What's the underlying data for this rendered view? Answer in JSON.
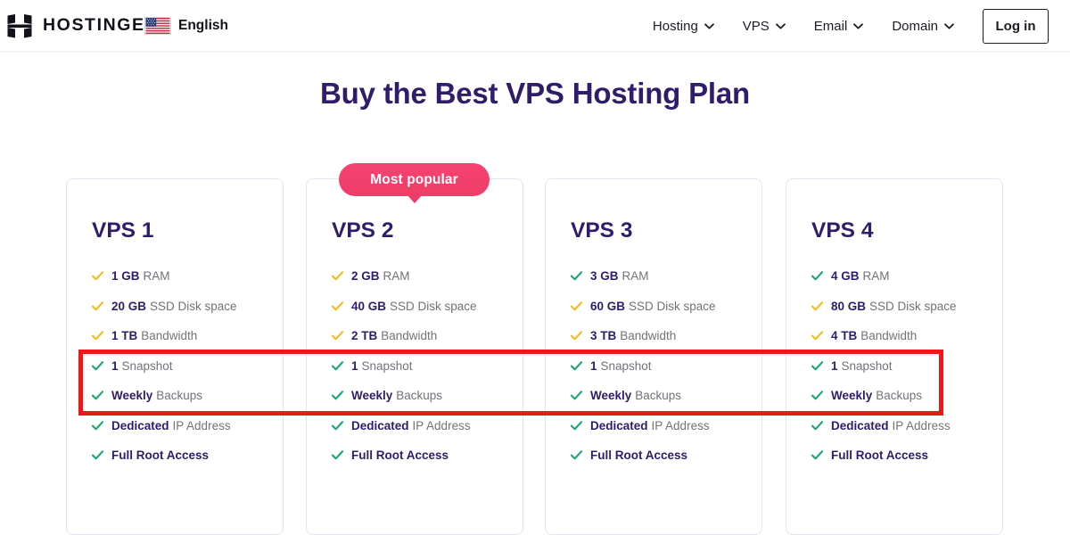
{
  "header": {
    "logo_icon": "hostinger-h-logo",
    "brand": "HOSTINGER",
    "language": {
      "flag_icon": "us-flag-icon",
      "label": "English"
    },
    "nav": [
      {
        "label": "Hosting",
        "icon": "chevron-down-icon"
      },
      {
        "label": "VPS",
        "icon": "chevron-down-icon"
      },
      {
        "label": "Email",
        "icon": "chevron-down-icon"
      },
      {
        "label": "Domain",
        "icon": "chevron-down-icon"
      }
    ],
    "login_label": "Log in"
  },
  "page": {
    "title": "Buy the Best VPS Hosting Plan",
    "title_color": "#2f1c6a"
  },
  "badge": {
    "label": "Most popular",
    "color": "#ee3d67"
  },
  "annotation": {
    "color": "#ef1717",
    "highlights": [
      "1 Snapshot",
      "Weekly Backups"
    ]
  },
  "colors": {
    "tick_green": "#17a673",
    "tick_yellow": "#f6ba1b",
    "card_border": "#e6e3f3",
    "value_text": "#2f1c6a",
    "label_text": "#727279"
  },
  "plans": [
    {
      "name": "VPS 1",
      "features": [
        {
          "value": "1 GB",
          "label": "RAM",
          "tick": "yellow"
        },
        {
          "value": "20 GB",
          "label": "SSD Disk space",
          "tick": "yellow"
        },
        {
          "value": "1 TB",
          "label": "Bandwidth",
          "tick": "yellow"
        },
        {
          "value": "1",
          "label": "Snapshot",
          "tick": "green"
        },
        {
          "value": "Weekly",
          "label": "Backups",
          "tick": "green"
        },
        {
          "value": "Dedicated",
          "label": "IP Address",
          "tick": "green"
        },
        {
          "value": "",
          "label": "Full Root Access",
          "tick": "green"
        }
      ]
    },
    {
      "name": "VPS 2",
      "features": [
        {
          "value": "2 GB",
          "label": "RAM",
          "tick": "yellow"
        },
        {
          "value": "40 GB",
          "label": "SSD Disk space",
          "tick": "yellow"
        },
        {
          "value": "2 TB",
          "label": "Bandwidth",
          "tick": "yellow"
        },
        {
          "value": "1",
          "label": "Snapshot",
          "tick": "green"
        },
        {
          "value": "Weekly",
          "label": "Backups",
          "tick": "green"
        },
        {
          "value": "Dedicated",
          "label": "IP Address",
          "tick": "green"
        },
        {
          "value": "",
          "label": "Full Root Access",
          "tick": "green"
        }
      ]
    },
    {
      "name": "VPS 3",
      "features": [
        {
          "value": "3 GB",
          "label": "RAM",
          "tick": "green"
        },
        {
          "value": "60 GB",
          "label": "SSD Disk space",
          "tick": "yellow"
        },
        {
          "value": "3 TB",
          "label": "Bandwidth",
          "tick": "yellow"
        },
        {
          "value": "1",
          "label": "Snapshot",
          "tick": "green"
        },
        {
          "value": "Weekly",
          "label": "Backups",
          "tick": "green"
        },
        {
          "value": "Dedicated",
          "label": "IP Address",
          "tick": "green"
        },
        {
          "value": "",
          "label": "Full Root Access",
          "tick": "green"
        }
      ]
    },
    {
      "name": "VPS 4",
      "features": [
        {
          "value": "4 GB",
          "label": "RAM",
          "tick": "green"
        },
        {
          "value": "80 GB",
          "label": "SSD Disk space",
          "tick": "yellow"
        },
        {
          "value": "4 TB",
          "label": "Bandwidth",
          "tick": "yellow"
        },
        {
          "value": "1",
          "label": "Snapshot",
          "tick": "green"
        },
        {
          "value": "Weekly",
          "label": "Backups",
          "tick": "green"
        },
        {
          "value": "Dedicated",
          "label": "IP Address",
          "tick": "green"
        },
        {
          "value": "",
          "label": "Full Root Access",
          "tick": "green"
        }
      ]
    }
  ]
}
